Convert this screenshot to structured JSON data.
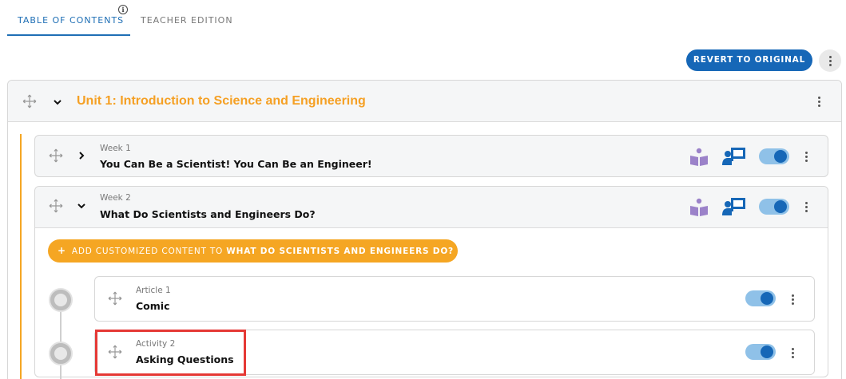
{
  "tabs": {
    "toc": "TABLE OF CONTENTS",
    "teacher": "TEACHER EDITION",
    "info_glyph": "i"
  },
  "toolbar": {
    "revert_label": "REVERT TO ORIGINAL"
  },
  "unit": {
    "title": "Unit 1: Introduction to Science and Engineering"
  },
  "weeks": [
    {
      "kicker": "Week 1",
      "title": "You Can Be a Scientist! You Can Be an Engineer!",
      "expanded": false,
      "enabled": true
    },
    {
      "kicker": "Week 2",
      "title": "What Do Scientists and Engineers Do?",
      "expanded": true,
      "enabled": true,
      "add_button": {
        "plus": "+",
        "prefix": "ADD CUSTOMIZED CONTENT TO ",
        "target": "WHAT DO SCIENTISTS AND ENGINEERS DO?"
      },
      "items": [
        {
          "kicker": "Article 1",
          "title": "Comic",
          "enabled": true
        },
        {
          "kicker": "Activity 2",
          "title": "Asking Questions",
          "enabled": true
        }
      ]
    }
  ],
  "icons": {
    "student_book": "student-book-icon",
    "teacher_presentation": "teacher-presentation-icon",
    "move": "move-icon",
    "kebab": "kebab-icon"
  },
  "colors": {
    "primary": "#1667b7",
    "accent_orange": "#f5a623",
    "toggle_track": "#8fc1e8",
    "highlight": "#e53935",
    "book_purple": "#9b82c9"
  }
}
